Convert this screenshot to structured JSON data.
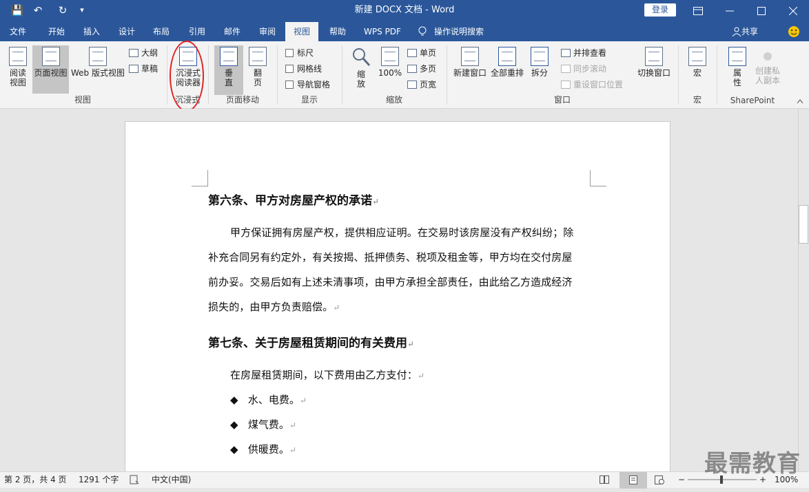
{
  "titlebar": {
    "title": "新建 DOCX 文档 - Word",
    "login": "登录",
    "save_icon": "💾",
    "undo_icon": "↶",
    "redo_icon": "↻",
    "qat_more": "▾"
  },
  "tabs": [
    "文件",
    "开始",
    "插入",
    "设计",
    "布局",
    "引用",
    "邮件",
    "审阅",
    "视图",
    "帮助",
    "WPS PDF",
    "操作说明搜索"
  ],
  "share": "共享",
  "ribbon": {
    "view_group": {
      "label": "视图",
      "read": "阅读\n视图",
      "print": "页面视图",
      "web": "Web 版式视图",
      "outline": "大纲",
      "draft": "草稿"
    },
    "immersive_group": {
      "label": "沉浸式",
      "reader": "沉浸式\n阅读器"
    },
    "pagemove_group": {
      "label": "页面移动",
      "vertical": "垂\n直",
      "flip": "翻\n页"
    },
    "show_group": {
      "label": "显示",
      "ruler": "标尺",
      "grid": "网格线",
      "nav": "导航窗格"
    },
    "zoom_group": {
      "label": "缩放",
      "zoom": "缩\n放",
      "hundred": "100%",
      "one": "单页",
      "multi": "多页",
      "width": "页宽"
    },
    "window_group": {
      "label": "窗口",
      "new": "新建窗口",
      "arrange": "全部重排",
      "split": "拆分",
      "side": "并排查看",
      "sync": "同步滚动",
      "reset": "重设窗口位置",
      "switch": "切换窗口"
    },
    "macro_group": {
      "label": "宏",
      "macro": "宏"
    },
    "sp_group": {
      "label": "SharePoint",
      "props": "属\n性",
      "private": "创建私\n人副本"
    }
  },
  "document": {
    "h6": "第六条、甲方对房屋产权的承诺",
    "p6": [
      "甲方保证拥有房屋产权，提供相应证明。在交易时该房屋没有产权纠纷；除",
      "补充合同另有约定外，有关按揭、抵押债务、税项及租金等，甲方均在交付房屋",
      "前办妥。交易后如有上述未清事项，由甲方承担全部责任，由此给乙方造成经济",
      "损失的，由甲方负责赔偿。"
    ],
    "h7": "第七条、关于房屋租赁期间的有关费用",
    "p7": "在房屋租赁期间，以下费用由乙方支付：",
    "bullets": [
      "水、电费。",
      "煤气费。",
      "供暖费。"
    ],
    "para_mark": "↵",
    "bullet_glyph": "◆"
  },
  "status": {
    "page": "第 2 页，共 4 页",
    "words": "1291 个字",
    "lang": "中文(中国)",
    "zoom": "100%"
  },
  "watermark": "最需教育"
}
